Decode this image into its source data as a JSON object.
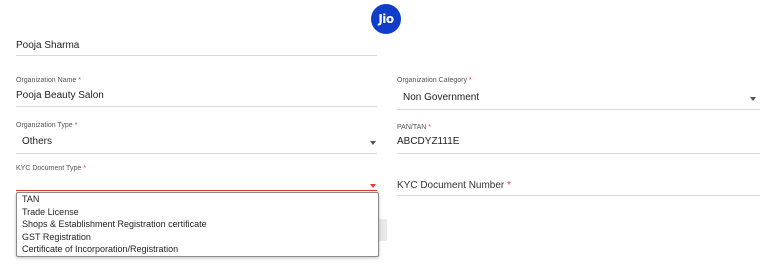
{
  "brand": {
    "logo_text": "Jio",
    "color": "#0f3cc9"
  },
  "name_field": {
    "value": "Pooja Sharma"
  },
  "org_name": {
    "label": "Organization Name",
    "required_mark": "*",
    "value": "Pooja Beauty Salon"
  },
  "org_category": {
    "label": "Organization Category",
    "required_mark": "*",
    "value": "Non Government"
  },
  "org_type": {
    "label": "Organization Type",
    "required_mark": "*",
    "value": "Others"
  },
  "pan_tan": {
    "label": "PAN/TAN",
    "required_mark": "*",
    "value": "ABCDYZ111E"
  },
  "kyc_doc_type": {
    "label": "KYC Document Type",
    "required_mark": "*",
    "value": "",
    "options": [
      "TAN",
      "Trade License",
      "Shops & Establishment Registration certificate",
      "GST Registration",
      "Certificate of Incorporation/Registration"
    ]
  },
  "kyc_doc_number": {
    "label": "KYC Document Number",
    "required_mark": "*",
    "value": ""
  },
  "colors": {
    "required": "#e53935",
    "divider": "#d9d9d9"
  }
}
